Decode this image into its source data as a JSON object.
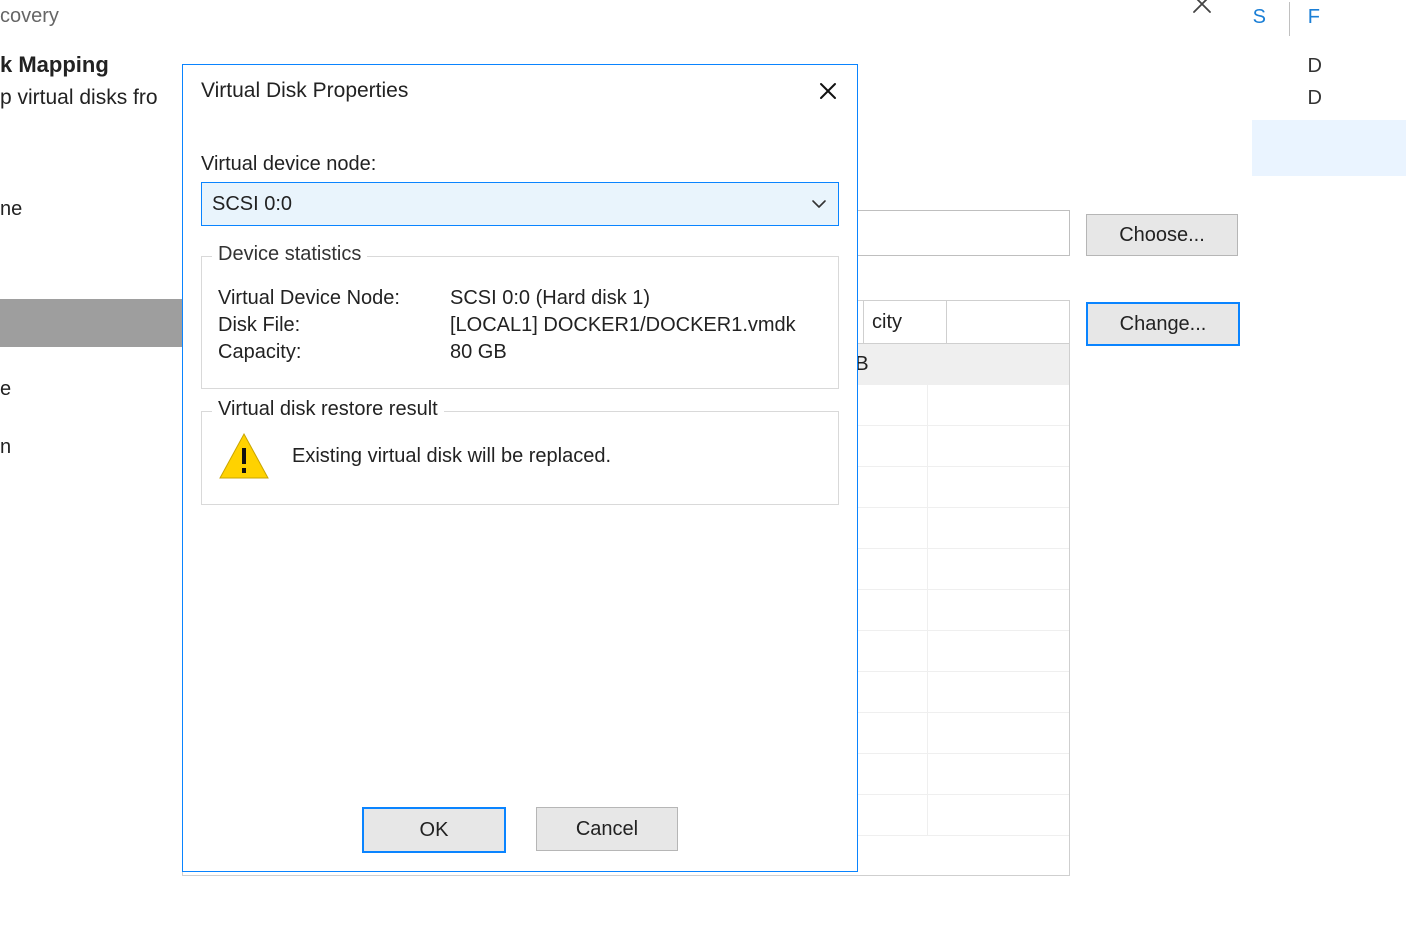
{
  "parent_window": {
    "title_fragment": "covery",
    "heading_fragment": "k Mapping",
    "subheading_fragment": "p virtual disks fro",
    "left_nav": [
      "ne",
      "",
      "e",
      "n"
    ],
    "left_nav_selected_index": 1,
    "choose_button": "Choose...",
    "change_button": "Change...",
    "grid": {
      "headers": [
        "",
        "city",
        ""
      ],
      "row0": [
        "",
        "B",
        ""
      ]
    },
    "topright": {
      "char1": "S",
      "char2": "F",
      "line1": "D",
      "line2": "D"
    }
  },
  "dialog": {
    "title": "Virtual Disk Properties",
    "device_node_label": "Virtual device node:",
    "device_node_value": "SCSI 0:0",
    "stats_legend": "Device statistics",
    "stats": {
      "node_label": "Virtual Device Node:",
      "node_value": "SCSI 0:0 (Hard disk 1)",
      "file_label": "Disk File:",
      "file_value": "[LOCAL1] DOCKER1/DOCKER1.vmdk",
      "capacity_label": "Capacity:",
      "capacity_value": "80 GB"
    },
    "result_legend": "Virtual disk restore result",
    "result_message": "Existing virtual disk will be replaced.",
    "ok": "OK",
    "cancel": "Cancel"
  }
}
